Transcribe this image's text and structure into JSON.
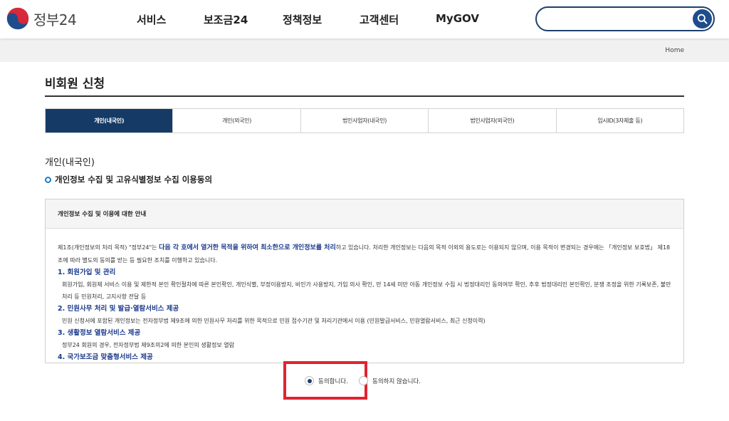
{
  "brand": {
    "name": "정부24"
  },
  "gnb": [
    "서비스",
    "보조금24",
    "정책정보",
    "고객센터",
    "MyGOV"
  ],
  "search": {
    "value": "",
    "placeholder": ""
  },
  "breadcrumb": "Home",
  "page_title": "비회원 신청",
  "tabs": [
    {
      "label": "개인(내국인)",
      "active": true
    },
    {
      "label": "개인(외국인)",
      "active": false
    },
    {
      "label": "법인사업자(내국인)",
      "active": false
    },
    {
      "label": "법인사업자(외국인)",
      "active": false
    },
    {
      "label": "임시ID(3자제출 등)",
      "active": false
    }
  ],
  "section_title": "개인(내국인)",
  "consent_title": "개인정보 수집 및 고유식별정보 수집 이용동의",
  "terms": {
    "header": "개인정보 수집 및 이용에 대한 안내",
    "intro_1": "제1조(개인정보의 처리 목적) \"정부24\"는 ",
    "intro_em": "다음 각 호에서 열거한 목적을 위하여 최소한으로 개인정보를 처리",
    "intro_2": "하고 있습니다. 처리한 개인정보는 다음의 목적 이외의 용도로는 이용되지 않으며, 이용 목적이 변경되는 경우에는 「개인정보 보호법」 제18조에 따라 별도의 동의를 받는 등 필요한 조치를 이행하고 있습니다.",
    "items": [
      {
        "title": "1. 회원가입 및 관리",
        "desc": "회원가입, 회원제 서비스 이용 및 제한적 본인 확인절차에 따른 본인확인, 개인식별, 부정이용방지, 비인가 사용방지, 가입 의사 확인, 만 14세 미만 아동 개인정보 수집 시 법정대리인 동의여부 확인, 추후 법정대리인 본인확인, 분쟁 조정을 위한 기록보존, 불만처리 등 민원처리, 고지사항 전달 등"
      },
      {
        "title": "2. 민원사무 처리 및 발급·열람서비스 제공",
        "desc": "민원 신청서에 포함된 개인정보는 전자정부법 제9조에 의한 민원사무 처리를 위한 목적으로 민원 접수기관 및 처리기관에서 이용 (민원발급서비스, 민원열람서비스, 최근 신청이력)"
      },
      {
        "title": "3. 생활정보 열람서비스 제공",
        "desc": "정부24 회원의 경우, 전자정부법 제9조의2에 의한 본인의 생활정보 열람"
      },
      {
        "title": "4. 국가보조금 맞춤형서비스 제공",
        "desc": ""
      }
    ]
  },
  "consent": {
    "agree": "동의합니다.",
    "disagree": "동의하지 않습니다.",
    "selected": "agree"
  },
  "colors": {
    "brand_navy": "#153a66",
    "accent_blue": "#1a3a8c",
    "highlight_red": "#e0242f"
  }
}
